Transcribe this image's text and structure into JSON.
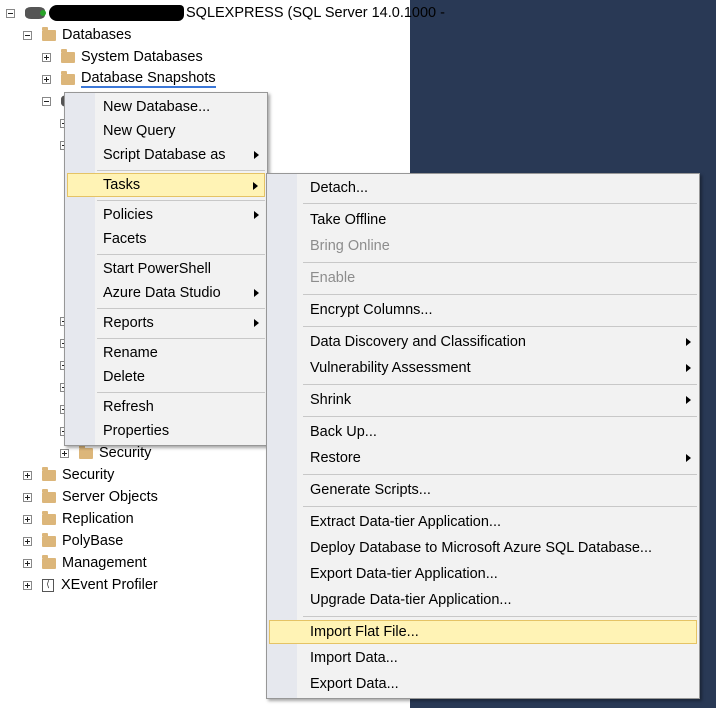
{
  "object_explorer": {
    "server_label": "SQLEXPRESS (SQL Server 14.0.1000 -",
    "databases": "Databases",
    "system_databases": "System Databases",
    "database_snapshots": "Database Snapshots",
    "db_security": "Security",
    "security": "Security",
    "server_objects": "Server Objects",
    "replication": "Replication",
    "polybase": "PolyBase",
    "management": "Management",
    "xevent_profiler": "XEvent Profiler"
  },
  "context_menu": {
    "items": [
      {
        "label": "New Database..."
      },
      {
        "label": "New Query"
      },
      {
        "label": "Script Database as",
        "submenu": true
      },
      {
        "label": "Tasks",
        "submenu": true,
        "highlighted": true
      },
      {
        "label": "Policies",
        "submenu": true
      },
      {
        "label": "Facets"
      },
      {
        "label": "Start PowerShell"
      },
      {
        "label": "Azure Data Studio",
        "submenu": true
      },
      {
        "label": "Reports",
        "submenu": true
      },
      {
        "label": "Rename"
      },
      {
        "label": "Delete"
      },
      {
        "label": "Refresh"
      },
      {
        "label": "Properties"
      }
    ]
  },
  "tasks_menu": {
    "items": [
      {
        "label": "Detach..."
      },
      {
        "label": "Take Offline"
      },
      {
        "label": "Bring Online",
        "disabled": true
      },
      {
        "label": "Enable",
        "disabled": true
      },
      {
        "label": "Encrypt Columns..."
      },
      {
        "label": "Data Discovery and Classification",
        "submenu": true
      },
      {
        "label": "Vulnerability Assessment",
        "submenu": true
      },
      {
        "label": "Shrink",
        "submenu": true
      },
      {
        "label": "Back Up..."
      },
      {
        "label": "Restore",
        "submenu": true
      },
      {
        "label": "Generate Scripts..."
      },
      {
        "label": "Extract Data-tier Application..."
      },
      {
        "label": "Deploy Database to Microsoft Azure SQL Database..."
      },
      {
        "label": "Export Data-tier Application..."
      },
      {
        "label": "Upgrade Data-tier Application..."
      },
      {
        "label": "Import Flat File...",
        "highlighted": true
      },
      {
        "label": "Import Data..."
      },
      {
        "label": "Export Data..."
      }
    ]
  },
  "colors": {
    "highlight": "#fff3b5",
    "highlight_border": "#e5c365",
    "background_pane": "#293955",
    "disabled_text": "#8d8d8d"
  }
}
